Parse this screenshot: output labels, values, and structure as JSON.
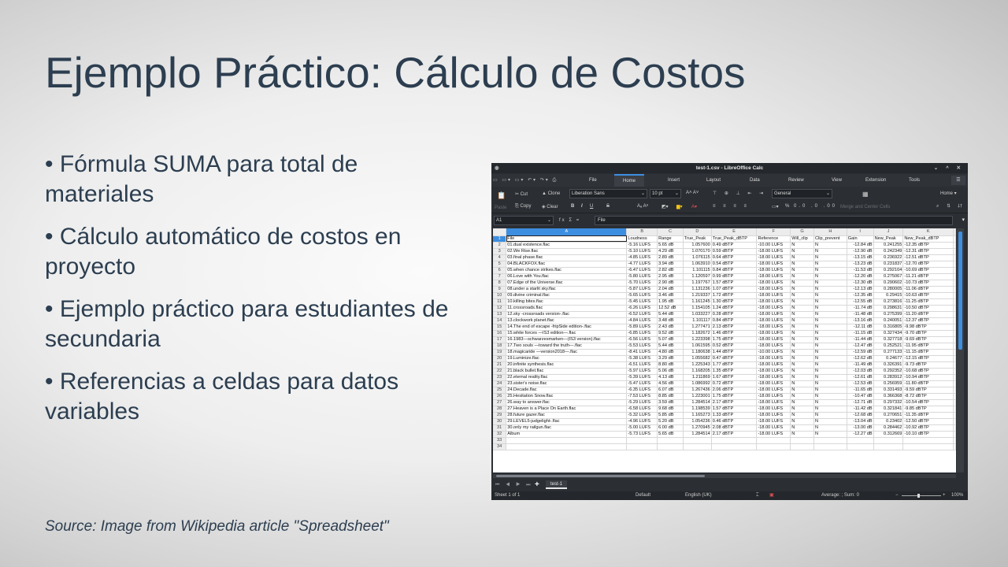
{
  "slide": {
    "title": "Ejemplo Práctico: Cálculo de Costos",
    "bullets": [
      "• Fórmula SUMA para total de materiales",
      "• Cálculo automático de costos en proyecto",
      "• Ejemplo práctico para estudiantes de secundaria",
      "• Referencias a celdas para datos variables"
    ],
    "source": "Source: Image from Wikipedia article \"Spreadsheet\""
  },
  "window": {
    "title": "test-1.csv - LibreOffice Calc",
    "controls": "⌄ ^ ✕",
    "menu": [
      "File",
      "Home",
      "Insert",
      "Layout",
      "Data",
      "Review",
      "View",
      "Extension",
      "Tools"
    ],
    "active_menu": "Home",
    "home_dropdown": "Home ▾",
    "accent": "#3d8ee0"
  },
  "toolbar": {
    "paste": "Paste",
    "cut": "Cut",
    "clone": "Clone",
    "copy": "Copy",
    "clear": "Clear",
    "font_name": "Liberation Sans",
    "font_size": "10 pt",
    "number_format": "General",
    "merge": "Merge and Center Cells",
    "bold": "B",
    "italic": "I",
    "underline": "U",
    "strike": "S",
    "percent": "%"
  },
  "formula": {
    "name_box": "A1",
    "content": "File",
    "fx_icons": "fx Σ ="
  },
  "sheet": {
    "columns": [
      "A",
      "B",
      "C",
      "D",
      "E",
      "F",
      "G",
      "H",
      "I",
      "J",
      "K"
    ],
    "selected_column": "A",
    "rows": [
      [
        "File",
        "Loudness",
        "Range",
        "True_Peak",
        "True_Peak_dBTP",
        "Reference",
        "Will_clip",
        "Clip_prevent",
        "Gain",
        "New_Peak",
        "New_Peak_dBTP"
      ],
      [
        "01.dual existence.flac",
        "-5.16 LUFS",
        "5.65 dB",
        "1.057600",
        "0.49 dBTP",
        "-10.00 LUFS",
        "N",
        "N",
        "-12.84 dB",
        "0.241255",
        "-12.35 dBTP"
      ],
      [
        "02.We Rise.flac",
        "-5.10 LUFS",
        "4.29 dB",
        "1.070170",
        "0.59 dBTP",
        "-18.00 LUFS",
        "N",
        "N",
        "-12.90 dB",
        "0.242349",
        "-12.31 dBTP"
      ],
      [
        "03.final phase.flac",
        "-4.85 LUFS",
        "2.89 dB",
        "1.076115",
        "0.64 dBTP",
        "-18.00 LUFS",
        "N",
        "N",
        "-13.15 dB",
        "0.236922",
        "-12.51 dBTP"
      ],
      [
        "04.BLACKFOX.flac",
        "-4.77 LUFS",
        "3.94 dB",
        "1.063910",
        "0.54 dBTP",
        "-18.00 LUFS",
        "N",
        "N",
        "-13.23 dB",
        "0.231837",
        "-12.70 dBTP"
      ],
      [
        "05.when chance strikes.flac",
        "-6.47 LUFS",
        "2.82 dB",
        "1.101115",
        "0.84 dBTP",
        "-18.00 LUFS",
        "N",
        "N",
        "-11.53 dB",
        "0.292104",
        "-10.69 dBTP"
      ],
      [
        "06.Love with You.flac",
        "-5.80 LUFS",
        "2.95 dB",
        "1.120597",
        "0.99 dBTP",
        "-18.00 LUFS",
        "N",
        "N",
        "-12.20 dB",
        "0.275067",
        "-11.21 dBTP"
      ],
      [
        "07.Edge of the Universe.flac",
        "-5.70 LUFS",
        "2.90 dB",
        "1.197767",
        "1.57 dBTP",
        "-18.00 LUFS",
        "N",
        "N",
        "-12.30 dB",
        "0.290602",
        "-10.73 dBTP"
      ],
      [
        "08.under a starlit sky.flac",
        "-5.87 LUFS",
        "2.04 dB",
        "1.131236",
        "1.07 dBTP",
        "-18.00 LUFS",
        "N",
        "N",
        "-12.13 dB",
        "0.280005",
        "-11.06 dBTP"
      ],
      [
        "09.divine criminal.flac",
        "-5.65 LUFS",
        "3.46 dB",
        "1.219337",
        "1.72 dBTP",
        "-18.00 LUFS",
        "N",
        "N",
        "-12.35 dB",
        "0.29415",
        "-10.63 dBTP"
      ],
      [
        "10.killing bites.flac",
        "-5.45 LUFS",
        "1.95 dB",
        "1.161245",
        "1.30 dBTP",
        "-18.00 LUFS",
        "N",
        "N",
        "-12.55 dB",
        "0.273816",
        "-11.25 dBTP"
      ],
      [
        "11.crossroads.flac",
        "-6.26 LUFS",
        "12.52 dB",
        "1.154105",
        "1.24 dBTP",
        "-18.00 LUFS",
        "N",
        "N",
        "-11.74 dB",
        "0.298631",
        "-10.50 dBTP"
      ],
      [
        "12.sky -crossroads version-.flac",
        "-6.52 LUFS",
        "5.44 dB",
        "1.033227",
        "0.28 dBTP",
        "-18.00 LUFS",
        "N",
        "N",
        "-11.48 dB",
        "0.275399",
        "-11.20 dBTP"
      ],
      [
        "13.clockwork planet.flac",
        "-4.84 LUFS",
        "3.48 dB",
        "1.101117",
        "0.84 dBTP",
        "-18.00 LUFS",
        "N",
        "N",
        "-13.16 dB",
        "0.240051",
        "-12.37 dBTP"
      ],
      [
        "14.The end of escape -fripSide edition-.flac",
        "-5.89 LUFS",
        "2.43 dB",
        "1.277471",
        "2.13 dBTP",
        "-18.00 LUFS",
        "N",
        "N",
        "-12.11 dB",
        "0.316805",
        "-9.98 dBTP"
      ],
      [
        "15.white forces —IS3 edition—.flac",
        "-6.85 LUFS",
        "9.52 dB",
        "1.182672",
        "1.46 dBTP",
        "-18.00 LUFS",
        "N",
        "N",
        "-11.15 dB",
        "0.327434",
        "-9.70 dBTP"
      ],
      [
        "16.1983—schwarzesmarken—(IS3 version).flac",
        "-6.56 LUFS",
        "5.07 dB",
        "1.223398",
        "1.75 dBTP",
        "-18.00 LUFS",
        "N",
        "N",
        "-11.44 dB",
        "0.327718",
        "-9.69 dBTP"
      ],
      [
        "17.Two souls —toward the truth—.flac",
        "-5.53 LUFS",
        "5.44 dB",
        "1.061595",
        "0.52 dBTP",
        "-18.00 LUFS",
        "N",
        "N",
        "-12.47 dB",
        "0.252521",
        "-11.95 dBTP"
      ],
      [
        "18.magicaride —version2018—.flac",
        "-8.41 LUFS",
        "4.80 dB",
        "1.180638",
        "1.44 dBTP",
        "-10.00 LUFS",
        "N",
        "N",
        "-12.59 dB",
        "0.277133",
        "-11.15 dBTP"
      ],
      [
        "19.Luminize.flac",
        "-5.38 LUFS",
        "3.29 dB",
        "1.055682",
        "0.47 dBTP",
        "-18.00 LUFS",
        "N",
        "N",
        "-12.62 dB",
        "0.24677",
        "-12.15 dBTP"
      ],
      [
        "20.infinite synthesis.flac",
        "-6.51 LUFS",
        "8.80 dB",
        "1.225343",
        "1.77 dBTP",
        "-18.00 LUFS",
        "N",
        "N",
        "-11.49 dB",
        "0.326391",
        "-9.73 dBTP"
      ],
      [
        "21.black bullet.flac",
        "-5.97 LUFS",
        "5.06 dB",
        "1.168205",
        "1.35 dBTP",
        "-18.00 LUFS",
        "N",
        "N",
        "-12.03 dB",
        "0.292352",
        "-10.68 dBTP"
      ],
      [
        "22.eternal reality.flac",
        "-5.39 LUFS",
        "4.13 dB",
        "1.211869",
        "1.67 dBTP",
        "-18.00 LUFS",
        "N",
        "N",
        "-12.61 dB",
        "0.283912",
        "-10.94 dBTP"
      ],
      [
        "23.sister's noise.flac",
        "-5.47 LUFS",
        "4.56 dB",
        "1.086992",
        "0.72 dBTP",
        "-18.00 LUFS",
        "N",
        "N",
        "-12.53 dB",
        "0.256959",
        "-11.80 dBTP"
      ],
      [
        "24.Decade.flac",
        "-6.35 LUFS",
        "6.07 dB",
        "1.267436",
        "2.06 dBTP",
        "-18.00 LUFS",
        "N",
        "N",
        "-11.65 dB",
        "0.331493",
        "-9.59 dBTP"
      ],
      [
        "25.Hesitation Snow.flac",
        "-7.53 LUFS",
        "8.85 dB",
        "1.223001",
        "1.75 dBTP",
        "-18.00 LUFS",
        "N",
        "N",
        "-10.47 dB",
        "0.366368",
        "-8.72 dBTP"
      ],
      [
        "26.way to answer.flac",
        "-5.29 LUFS",
        "3.59 dB",
        "1.284514",
        "2.17 dBTP",
        "-18.00 LUFS",
        "N",
        "N",
        "-12.71 dB",
        "0.297332",
        "-10.54 dBTP"
      ],
      [
        "27.Heaven is a Place On Earth.flac",
        "-6.58 LUFS",
        "9.68 dB",
        "1.198539",
        "1.57 dBTP",
        "-18.00 LUFS",
        "N",
        "N",
        "-11.42 dB",
        "0.321841",
        "-9.85 dBTP"
      ],
      [
        "28.future gazer.flac",
        "-5.32 LUFS",
        "5.85 dB",
        "1.165273",
        "1.33 dBTP",
        "-18.00 LUFS",
        "N",
        "N",
        "-12.68 dB",
        "0.270651",
        "-11.35 dBTP"
      ],
      [
        "29.LEVEL5-judgelight-.flac",
        "-4.96 LUFS",
        "5.20 dB",
        "1.054236",
        "0.46 dBTP",
        "-18.00 LUFS",
        "N",
        "N",
        "-13.04 dB",
        "0.23402",
        "-12.50 dBTP"
      ],
      [
        "30.only my railgun.flac",
        "-5.00 LUFS",
        "6.00 dB",
        "1.270945",
        "2.08 dBTP",
        "-18.00 LUFS",
        "N",
        "N",
        "-13.00 dB",
        "0.284462",
        "-10.92 dBTP"
      ],
      [
        "Album",
        "-5.73 LUFS",
        "5.65 dB",
        "1.284514",
        "2.17 dBTP",
        "-18.00 LUFS",
        "N",
        "N",
        "-12.27 dB",
        "0.312669",
        "-10.10 dBTP"
      ],
      [
        "",
        "",
        "",
        "",
        "",
        "",
        "",
        "",
        "",
        "",
        ""
      ],
      [
        "",
        "",
        "",
        "",
        "",
        "",
        "",
        "",
        "",
        "",
        ""
      ]
    ]
  },
  "tabs": {
    "sheet_tab": "test-1",
    "add": "+",
    "nav": "⏮ ◀ ▶ ⏭"
  },
  "status": {
    "sheet": "Sheet 1 of 1",
    "style": "Default",
    "language": "English (UK)",
    "summary": "Average: ; Sum: 0",
    "zoom": "100%",
    "zoom_minus": "−",
    "zoom_plus": "+"
  }
}
